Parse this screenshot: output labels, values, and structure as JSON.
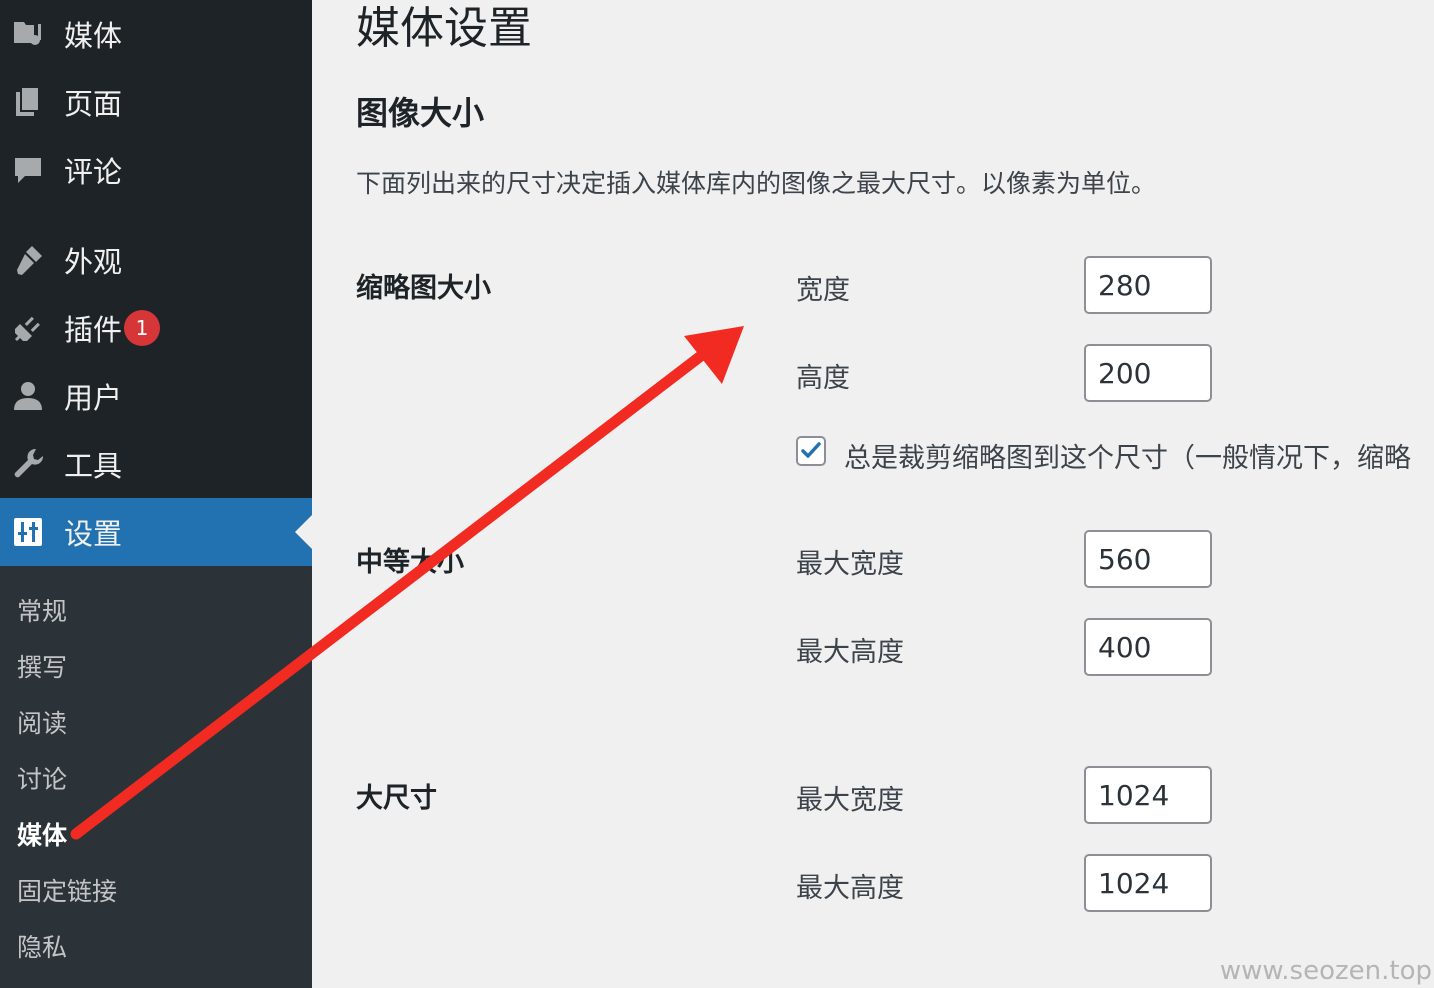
{
  "sidebar": {
    "items": [
      {
        "label": "媒体",
        "icon": "media-icon"
      },
      {
        "label": "页面",
        "icon": "pages-icon"
      },
      {
        "label": "评论",
        "icon": "comments-icon"
      },
      {
        "label": "外观",
        "icon": "appearance-icon"
      },
      {
        "label": "插件",
        "icon": "plugins-icon",
        "badge": "1"
      },
      {
        "label": "用户",
        "icon": "users-icon"
      },
      {
        "label": "工具",
        "icon": "tools-icon"
      },
      {
        "label": "设置",
        "icon": "settings-icon"
      }
    ],
    "submenu": [
      "常规",
      "撰写",
      "阅读",
      "讨论",
      "媒体",
      "固定链接",
      "隐私"
    ]
  },
  "main": {
    "page_title": "媒体设置",
    "section_title": "图像大小",
    "description": "下面列出来的尺寸决定插入媒体库内的图像之最大尺寸。以像素为单位。",
    "thumbnail": {
      "heading": "缩略图大小",
      "width_label": "宽度",
      "width_value": "280",
      "height_label": "高度",
      "height_value": "200",
      "crop_label": "总是裁剪缩略图到这个尺寸（一般情况下，缩略",
      "crop_checked": true
    },
    "medium": {
      "heading": "中等大小",
      "width_label": "最大宽度",
      "width_value": "560",
      "height_label": "最大高度",
      "height_value": "400"
    },
    "large": {
      "heading": "大尺寸",
      "width_label": "最大宽度",
      "width_value": "1024",
      "height_label": "最大高度",
      "height_value": "1024"
    }
  },
  "watermark": "www.seozen.top",
  "colors": {
    "sidebar_bg": "#1d2327",
    "submenu_bg": "#2c3338",
    "active_menu": "#2271b1",
    "badge": "#d63638",
    "checkbox_check": "#2271b1",
    "annotation_arrow": "#f22b22"
  }
}
